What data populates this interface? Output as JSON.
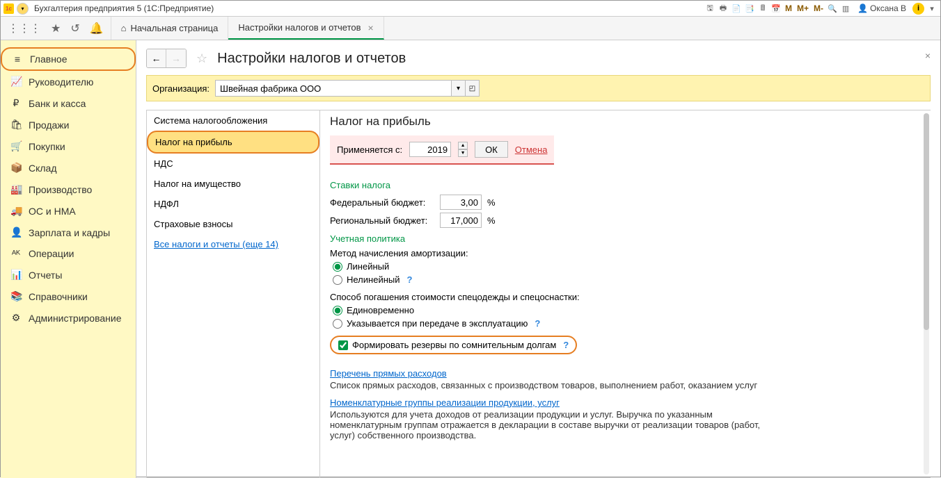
{
  "titlebar": {
    "appTitle": "Бухгалтерия предприятия 5  (1С:Предприятие)",
    "m1": "M",
    "m2": "M+",
    "m3": "M-",
    "user": "Оксана В"
  },
  "tabs": {
    "home": "Начальная страница",
    "active": "Настройки налогов и отчетов"
  },
  "nav": {
    "items": [
      {
        "icon": "≡",
        "label": "Главное",
        "active": true
      },
      {
        "icon": "📈",
        "label": "Руководителю"
      },
      {
        "icon": "₽",
        "label": "Банк и касса"
      },
      {
        "icon": "🛍",
        "label": "Продажи"
      },
      {
        "icon": "🛒",
        "label": "Покупки"
      },
      {
        "icon": "📦",
        "label": "Склад"
      },
      {
        "icon": "🏭",
        "label": "Производство"
      },
      {
        "icon": "🚚",
        "label": "ОС и НМА"
      },
      {
        "icon": "👤",
        "label": "Зарплата и кадры"
      },
      {
        "icon": "ᴬᴷ",
        "label": "Операции"
      },
      {
        "icon": "📊",
        "label": "Отчеты"
      },
      {
        "icon": "📚",
        "label": "Справочники"
      },
      {
        "icon": "⚙",
        "label": "Администрирование"
      }
    ]
  },
  "page": {
    "title": "Настройки налогов и отчетов",
    "orgLabel": "Организация:",
    "orgValue": "Швейная фабрика ООО"
  },
  "settingsNav": {
    "items": [
      "Система налогообложения",
      "Налог на прибыль",
      "НДС",
      "Налог на имущество",
      "НДФЛ",
      "Страховые взносы"
    ],
    "link": "Все налоги и отчеты (еще 14)"
  },
  "profit": {
    "heading": "Налог на прибыль",
    "applyLabel": "Применяется с:",
    "applyYear": "2019",
    "ok": "ОК",
    "cancel": "Отмена",
    "ratesLabel": "Ставки налога",
    "fedLabel": "Федеральный бюджет:",
    "fedValue": "3,00",
    "regLabel": "Региональный бюджет:",
    "regValue": "17,000",
    "pct": "%",
    "policyLabel": "Учетная политика",
    "amortLabel": "Метод начисления амортизации:",
    "amortLinear": "Линейный",
    "amortNonlinear": "Нелинейный",
    "wearLabel": "Способ погашения стоимости спецодежды и спецоснастки:",
    "wearOnce": "Единовременно",
    "wearOnUse": "Указывается при передаче в эксплуатацию",
    "reserveLabel": "Формировать резервы по сомнительным долгам",
    "directLink": "Перечень прямых расходов",
    "directDesc": "Список прямых расходов, связанных с производством товаров, выполнением работ, оказанием услуг",
    "nomLink": "Номенклатурные группы реализации продукции, услуг",
    "nomDesc": "Используются для учета доходов от реализации продукции и услуг. Выручка по указанным номенклатурным группам отражается в декларации в составе выручки от реализации товаров (работ, услуг) собственного производства."
  }
}
